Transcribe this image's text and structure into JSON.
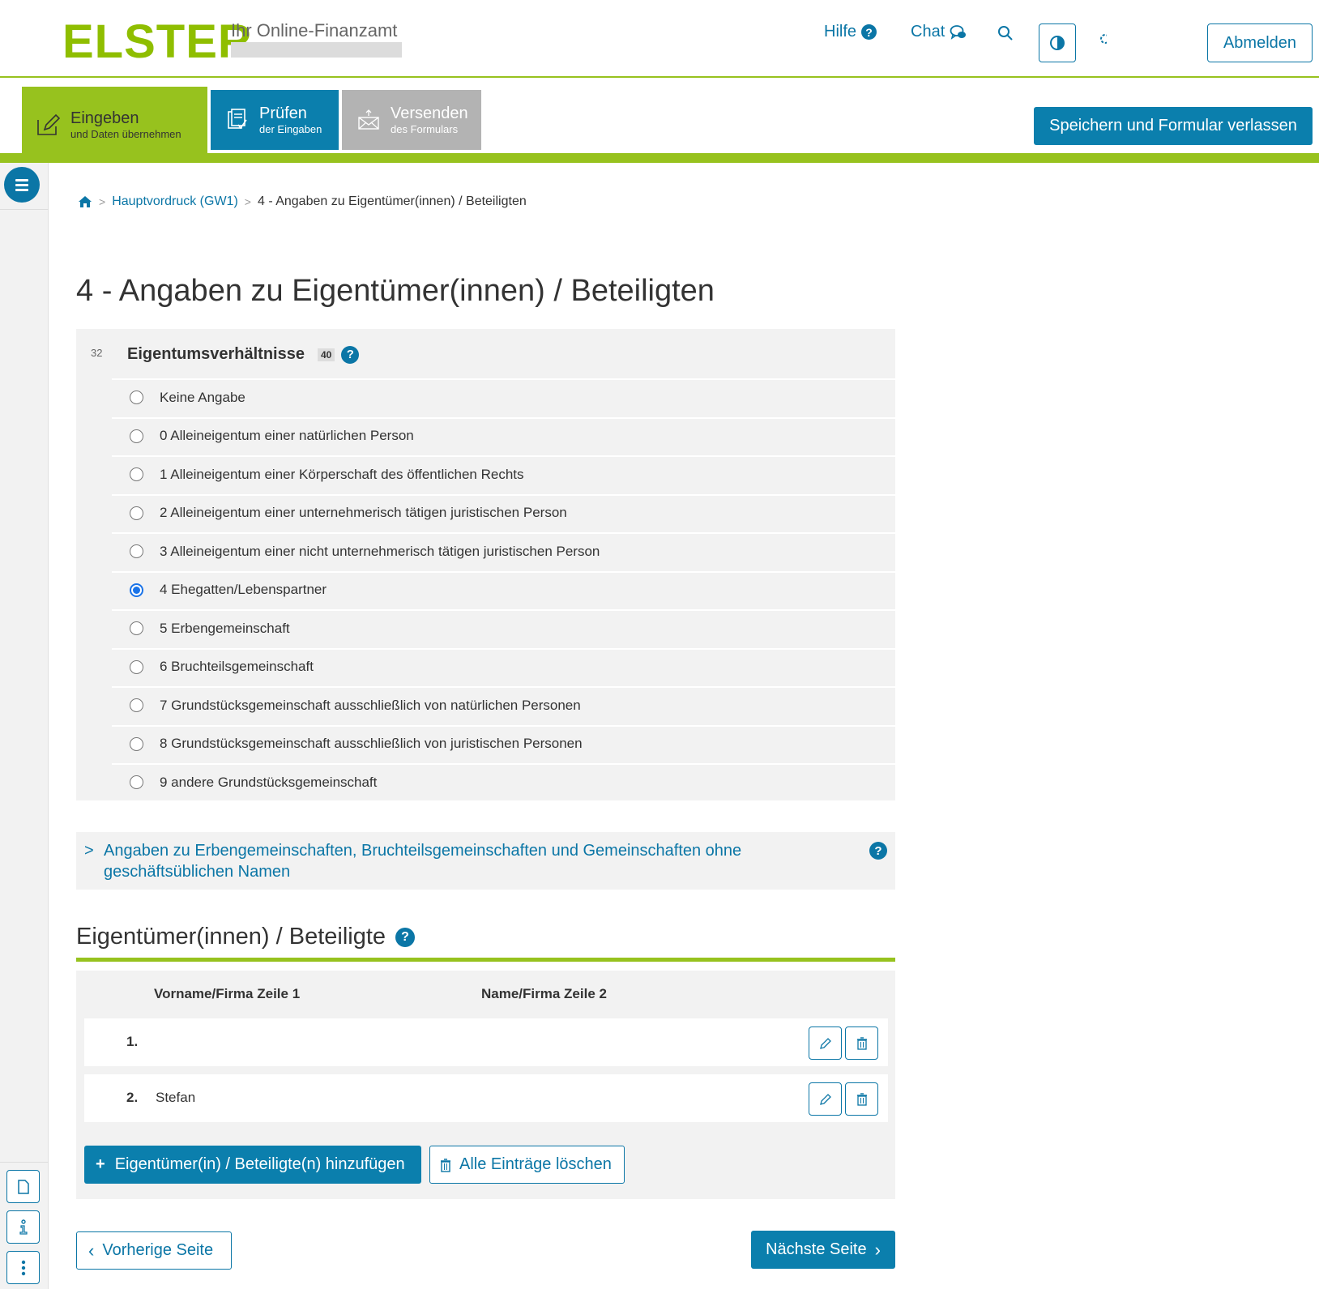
{
  "header": {
    "logo": "ELSTER",
    "logo_subtitle": "Ihr Online-Finanzamt",
    "nav": {
      "help_label": "Hilfe",
      "help_badge": "?",
      "chat_label": "Chat",
      "logout_label": "Abmelden"
    },
    "icons": [
      "help-icon",
      "chat-icon",
      "search-icon",
      "contrast-icon",
      "settings-icon"
    ]
  },
  "steps": [
    {
      "title": "Eingeben",
      "subtitle": "und Daten übernehmen",
      "state": "active",
      "icon": "edit-icon"
    },
    {
      "title": "Prüfen",
      "subtitle": "der Eingaben",
      "state": "available",
      "icon": "checklist-icon"
    },
    {
      "title": "Versenden",
      "subtitle": "des Formulars",
      "state": "disabled",
      "icon": "send-mail-icon"
    }
  ],
  "save_exit_label": "Speichern und Formular verlassen",
  "colors": {
    "brand_green": "#97c21e",
    "primary_blue": "#0b7fad",
    "disabled_gray": "#b3b3b3",
    "panel_bg": "#f2f2f2"
  },
  "breadcrumb": {
    "home_icon": "home-icon",
    "items": [
      "Hauptvordruck (GW1)",
      "4 - Angaben zu Eigentümer(innen) / Beteiligten"
    ]
  },
  "page_title": "4 - Angaben zu Eigentümer(innen) / Beteiligten",
  "ownership": {
    "line_number": "32",
    "legend": "Eigentumsverhältnisse",
    "kennzahl": "40",
    "help_badge": "?",
    "selected_index": 5,
    "options": [
      "Keine Angabe",
      "0 Alleineigentum einer natürlichen Person",
      "1 Alleineigentum einer Körperschaft des öffentlichen Rechts",
      "2 Alleineigentum einer unternehmerisch tätigen juristischen Person",
      "3 Alleineigentum einer nicht unternehmerisch tätigen juristischen Person",
      "4 Ehegatten/Lebenspartner",
      "5 Erbengemeinschaft",
      "6 Bruchteilsgemeinschaft",
      "7 Grundstücksgemeinschaft ausschließlich von natürlichen Personen",
      "8 Grundstücksgemeinschaft ausschließlich von juristischen Personen",
      "9 andere Grundstücksgemeinschaft"
    ]
  },
  "expander": {
    "label": "Angaben zu Erbengemeinschaften, Bruchteilsgemeinschaften und Gemeinschaften ohne geschäftsüblichen Namen",
    "help_badge": "?"
  },
  "owners": {
    "title": "Eigentümer(innen) / Beteiligte",
    "help_badge": "?",
    "columns": [
      "Vorname/Firma Zeile 1",
      "Name/Firma Zeile 2"
    ],
    "rows": [
      {
        "num": "1.",
        "first": "",
        "second": ""
      },
      {
        "num": "2.",
        "first": "Stefan",
        "second": ""
      }
    ],
    "add_label": "Eigentümer(in) / Beteiligte(n) hinzufügen",
    "add_plus": "+",
    "delete_all_label": "Alle Einträge löschen"
  },
  "pager": {
    "prev_label": "Vorherige Seite",
    "next_label": "Nächste Seite",
    "prev_chevron": "‹",
    "next_chevron": "›"
  }
}
